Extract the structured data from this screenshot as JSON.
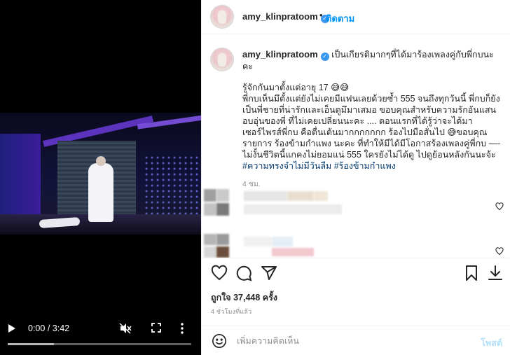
{
  "video": {
    "current_time": "0:00",
    "duration": "3:42",
    "buffered_fraction": 0.25
  },
  "header": {
    "username": "amy_klinpratoom",
    "verified_mark": "✓",
    "separator": "•",
    "follow_label": "ติดตาม"
  },
  "caption": {
    "username": "amy_klinpratoom",
    "verified_mark": "✓",
    "headline": "เป็นเกียรติมากๆที่ได้มาร้องเพลงคู่กับพี่กบนะคะ",
    "line1": "รู้จักกันมาตั้งแต่อายุ 17 😅😅",
    "body": "พี่กบเห็นมึตั้งแต่ยังไม่เคยมีแฟนเลยด้วยซ้ำ 555 จนถึงทุกวันนี้ พี่กบก็ยังเป็นพี่ชายที่น่ารักและเอ็นดูมึมาเสมอ ขอบคุณสำหรับความรักอันแสนอบอุ่นของพี่ ที่ไม่เคยเปลี่ยนนะคะ .... ตอนแรกที่ได้รู้ว่าจะได้มาเซอร์ไพรส์พี่กบ คือตื่นเต้นมากกกกกกก ร้องไปมือสั่นไป 😅ขอบคุณรายการ ร้องข้ามกำแพง นะคะ ที่ทำให้มีได้มีโอกาสร้องเพลงคู่พี่กบ —- ไม่งั้นชีวิตนี้แกคงไม่ยอมแน่ 555 ใครยังไม่ได้ดู ไปดูย้อนหลังกันนะจ้ะ ",
    "tag1": "#ความทรงจำไม่มีวันลืม",
    "tag2": "#ร้องข้ามกำแพง",
    "time": "4 ชม."
  },
  "colors": {
    "accent": "#0095f6",
    "verified": "#3897f0",
    "hashtag": "#00376b",
    "muted": "#8e8e8e",
    "post_disabled": "#b2dffc"
  },
  "icons": {
    "play": "play-icon",
    "mute": "volume-muted-icon",
    "fullscreen": "fullscreen-icon",
    "more": "more-vertical-icon",
    "like": "heart-icon",
    "comment": "comment-icon",
    "share": "share-icon",
    "save": "bookmark-icon",
    "emoji": "emoji-icon"
  },
  "stats": {
    "likes_label": "ถูกใจ",
    "likes_count": "37,448",
    "likes_suffix": "ครั้ง",
    "posted_ago": "4 ชั่วโมงที่แล้ว"
  },
  "comment_box": {
    "placeholder": "เพิ่มความคิดเห็น",
    "post_label": "โพสต์"
  }
}
